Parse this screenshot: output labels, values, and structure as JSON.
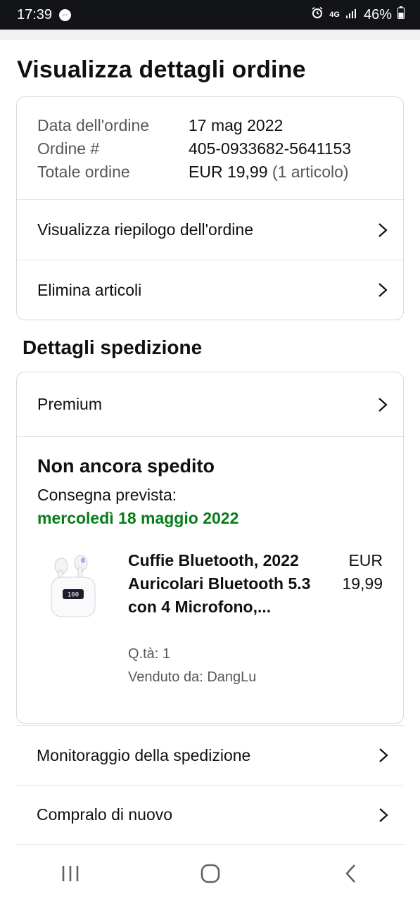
{
  "status_bar": {
    "time": "17:39",
    "network": "4G",
    "battery": "46%"
  },
  "page_title": "Visualizza dettagli ordine",
  "order_summary": {
    "rows": [
      {
        "label": "Data dell'ordine",
        "value": "17 mag 2022"
      },
      {
        "label": "Ordine #",
        "value": "405-0933682-5641153"
      },
      {
        "label": "Totale ordine",
        "value": "EUR 19,99",
        "extra": "(1 articolo)"
      }
    ],
    "links": [
      "Visualizza riepilogo dell'ordine",
      "Elimina articoli"
    ]
  },
  "shipping": {
    "title": "Dettagli spedizione",
    "service": "Premium",
    "status": "Non ancora spedito",
    "delivery_label": "Consegna prevista:",
    "delivery_date": "mercoledì 18 maggio 2022",
    "product": {
      "title": "Cuffie Bluetooth, 2022 Auricolari Bluetooth 5.3 con 4 Microfono,...",
      "price_currency": "EUR",
      "price_amount": "19,99",
      "quantity": "Q.tà: 1",
      "seller": "Venduto da: DangLu",
      "case_display": "100"
    }
  },
  "actions": [
    "Monitoraggio della spedizione",
    "Compralo di nuovo"
  ],
  "colors": {
    "delivery_green": "#067d18",
    "muted_text": "#565959",
    "border": "#d5d9d9"
  },
  "icons": [
    "messenger-icon",
    "alarm-icon",
    "signal-icon",
    "battery-icon",
    "chevron-right-icon",
    "recents-icon",
    "home-icon",
    "back-icon"
  ]
}
